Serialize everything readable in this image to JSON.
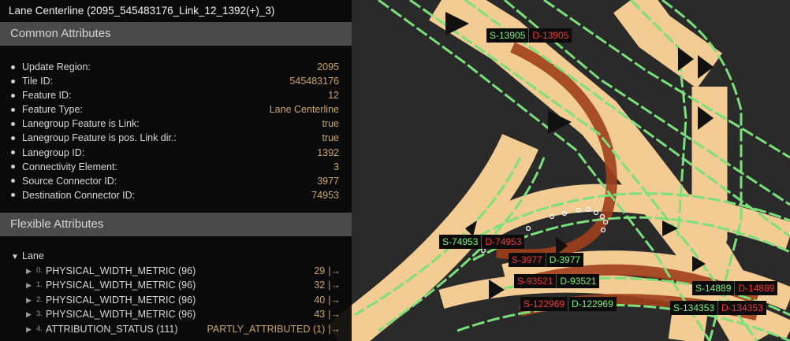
{
  "panel": {
    "title": "Lane Centerline (2095_545483176_Link_12_1392(+)_3)",
    "common_header": "Common Attributes",
    "common": [
      {
        "key": "Update Region:",
        "value": "2095"
      },
      {
        "key": "Tile ID:",
        "value": "545483176"
      },
      {
        "key": "Feature ID:",
        "value": "12"
      },
      {
        "key": "Feature Type:",
        "value": "Lane Centerline"
      },
      {
        "key": "Lanegroup Feature is Link:",
        "value": "true"
      },
      {
        "key": "Lanegroup Feature is pos. Link dir.:",
        "value": "true"
      },
      {
        "key": "Lanegroup ID:",
        "value": "1392"
      },
      {
        "key": "Connectivity Element:",
        "value": "3"
      },
      {
        "key": "Source Connector ID:",
        "value": "3977"
      },
      {
        "key": "Destination Connector ID:",
        "value": "74953"
      }
    ],
    "flexible_header": "Flexible Attributes",
    "lane_label": "Lane",
    "flexible": [
      {
        "index": "0.",
        "key": "PHYSICAL_WIDTH_METRIC (96)",
        "value": "29",
        "link": "|→"
      },
      {
        "index": "1.",
        "key": "PHYSICAL_WIDTH_METRIC (96)",
        "value": "32",
        "link": "|→"
      },
      {
        "index": "2.",
        "key": "PHYSICAL_WIDTH_METRIC (96)",
        "value": "40",
        "link": "|→"
      },
      {
        "index": "3.",
        "key": "PHYSICAL_WIDTH_METRIC (96)",
        "value": "43",
        "link": "|→"
      },
      {
        "index": "4.",
        "key": "ATTRIBUTION_STATUS (111)",
        "value": "PARTLY_ATTRIBUTED (1)",
        "link": "|→"
      }
    ]
  },
  "map_labels": [
    {
      "first": "S-13905",
      "second": "D-13905"
    },
    {
      "first": "S-74953",
      "second": "D-74953"
    },
    {
      "first": "S-3977",
      "second": "D-3977"
    },
    {
      "first": "S-93521",
      "second": "D-93521"
    },
    {
      "first": "S-122969",
      "second": "D-122969"
    },
    {
      "first": "S-14889",
      "second": "D-14889"
    },
    {
      "first": "S-134353",
      "second": "D-134353"
    }
  ],
  "colors": {
    "road": "#f2cc93",
    "lane_line": "#7be07b",
    "selected_lane": "#a0401c",
    "background": "#2a2a2a",
    "value_text": "#c9a56c"
  }
}
